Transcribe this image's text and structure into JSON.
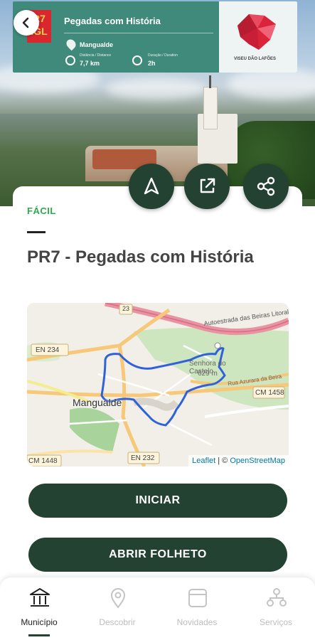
{
  "banner": {
    "badge_line1": "R7",
    "badge_line2": "IGL",
    "title": "Pegadas com História",
    "place": "Mangualde",
    "distance_caption": "Distância / Distance",
    "distance_value": "7,7 km",
    "duration_caption": "Duração / Duration",
    "duration_value": "2h",
    "logo_text": "VISEU DÃO LAFÕES"
  },
  "route": {
    "difficulty": "FÁCIL",
    "title": "PR7 - Pegadas com História"
  },
  "map": {
    "labels": {
      "road_a": "Autoestrada das Beiras Litoral e Alta",
      "en234": "EN 234",
      "en232": "EN 232",
      "cm1458": "CM 1458",
      "cm1448": "CM 1448",
      "road_num": "23",
      "town": "Mangualde",
      "peak": "Senhora do Castelo",
      "peak_alt": "629 m",
      "street": "Rua Azurara da Beira"
    },
    "attribution_lib": "Leaflet",
    "attribution_sep": " | © ",
    "attribution_osm": "OpenStreetMap"
  },
  "actions": {
    "start": "INICIAR",
    "brochure": "ABRIR FOLHETO"
  },
  "nav": {
    "items": [
      {
        "label": "Município",
        "icon": "building-icon",
        "active": true
      },
      {
        "label": "Descobrir",
        "icon": "location-pin-icon",
        "active": false
      },
      {
        "label": "Novidades",
        "icon": "calendar-icon",
        "active": false
      },
      {
        "label": "Serviços",
        "icon": "network-icon",
        "active": false
      }
    ]
  },
  "colors": {
    "primary": "#244232",
    "difficulty": "#2fa84f",
    "route_line": "#2f62d8"
  }
}
